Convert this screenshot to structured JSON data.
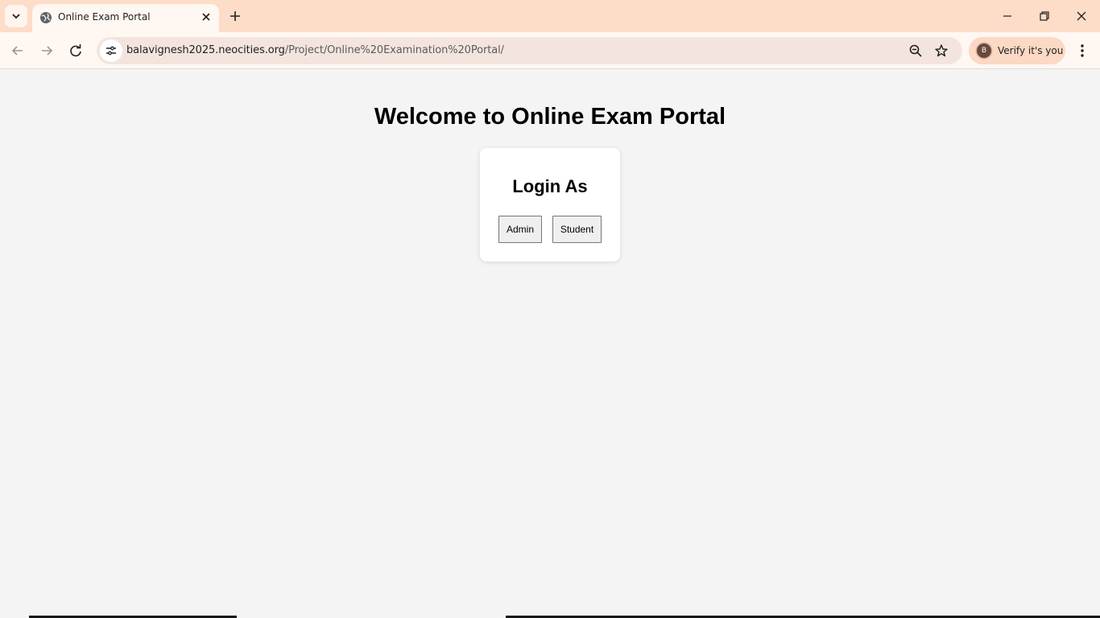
{
  "browser": {
    "tab": {
      "title": "Online Exam Portal"
    },
    "address_bar": {
      "host": "balavignesh2025.neocities.org",
      "path": "/Project/Online%20Examination%20Portal/"
    },
    "profile": {
      "initial": "B",
      "label": "Verify it's you"
    },
    "colors": {
      "tabbar_bg": "#fddcc8",
      "toolbar_bg": "#fff7f2",
      "omnibox_bg": "#f3e5de",
      "verify_bg": "#fbd9c4"
    },
    "icons": [
      "tab-search-icon",
      "globe-icon",
      "close-icon",
      "plus-icon",
      "minimize-icon",
      "restore-icon",
      "close-window-icon",
      "back-icon",
      "forward-icon",
      "reload-icon",
      "site-info-icon",
      "zoom-icon",
      "star-icon",
      "kebab-menu-icon"
    ]
  },
  "page": {
    "title": "Welcome to Online Exam Portal",
    "login_card": {
      "heading": "Login As",
      "admin_label": "Admin",
      "student_label": "Student"
    },
    "colors": {
      "background": "#f4f4f4",
      "card": "#ffffff",
      "button": "#efefef"
    }
  }
}
